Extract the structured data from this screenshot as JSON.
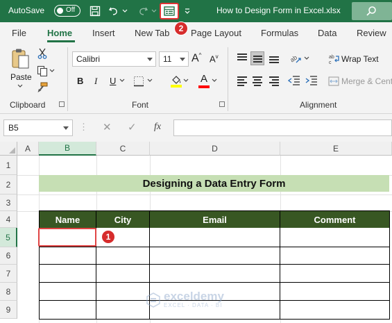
{
  "titlebar": {
    "autosave_label": "AutoSave",
    "autosave_state": "Off",
    "doc_title": "How to Design Form in Excel.xlsx",
    "form_badge": "2"
  },
  "tabs": [
    "File",
    "Home",
    "Insert",
    "New Tab",
    "Page Layout",
    "Formulas",
    "Data",
    "Review"
  ],
  "active_tab": "Home",
  "ribbon": {
    "clipboard": {
      "paste_label": "Paste",
      "group_label": "Clipboard"
    },
    "font": {
      "font_name": "Calibri",
      "font_size": "11",
      "bold": "B",
      "italic": "I",
      "underline": "U",
      "grow": "A",
      "shrink": "A",
      "font_color": "A",
      "group_label": "Font"
    },
    "alignment": {
      "wrap_text": "Wrap Text",
      "merge_center": "Merge & Cent",
      "group_label": "Alignment"
    },
    "colors": {
      "fill": "#ffff00",
      "font": "#ff0000",
      "accent": "#217346"
    }
  },
  "formula_bar": {
    "name_box": "B5",
    "fx": "fx",
    "value": ""
  },
  "columns": [
    "A",
    "B",
    "C",
    "D",
    "E"
  ],
  "rows": [
    "1",
    "2",
    "3",
    "4",
    "5",
    "6",
    "7",
    "8",
    "9"
  ],
  "sheet": {
    "banner_title": "Designing a Data Entry Form",
    "headers": [
      "Name",
      "City",
      "Email",
      "Comment"
    ],
    "selected_cell_badge": "1"
  },
  "watermark": {
    "name": "exceldemy",
    "sub": "EXCEL · DATA · BI"
  }
}
